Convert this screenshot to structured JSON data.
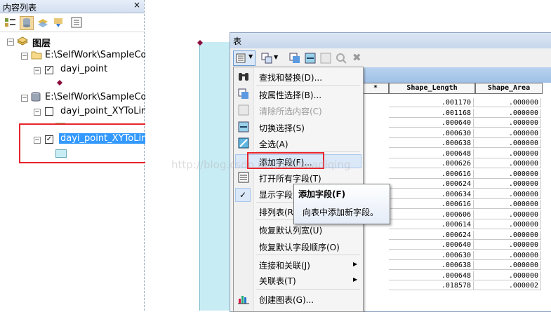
{
  "toc": {
    "title": "内容列表",
    "pin_glyph": "ᅟ",
    "close_glyph": "×",
    "layers_root": "图层",
    "workspace1": "E:\\SelfWork\\SampleCo",
    "layer1": "dayi_point",
    "workspace2": "E:\\SelfWork\\SampleCo",
    "layer2": "dayi_point_XYToLine",
    "layer3": "dayi_point_XYToLine"
  },
  "table_window": {
    "title": "表"
  },
  "grid": {
    "headers": [
      "*",
      "Shape_Length",
      "Shape_Area"
    ],
    "rows": [
      [
        ".001170",
        ".000000"
      ],
      [
        ".001168",
        ".000000"
      ],
      [
        ".000640",
        ".000000"
      ],
      [
        ".000630",
        ".000000"
      ],
      [
        ".000638",
        ".000000"
      ],
      [
        ".000648",
        ".000000"
      ],
      [
        ".000626",
        ".000000"
      ],
      [
        ".000616",
        ".000000"
      ],
      [
        ".000624",
        ".000000"
      ],
      [
        ".000634",
        ".000000"
      ],
      [
        ".000616",
        ".000000"
      ],
      [
        ".000606",
        ".000000"
      ],
      [
        ".000614",
        ".000000"
      ],
      [
        ".000624",
        ".000000"
      ],
      [
        ".000640",
        ".000000"
      ],
      [
        ".000630",
        ".000000"
      ],
      [
        ".000638",
        ".000000"
      ],
      [
        ".000648",
        ".000000"
      ],
      [
        ".018578",
        ".000002"
      ]
    ]
  },
  "menu": {
    "find_replace": "查找和替换(D)...",
    "select_by_attr": "按属性选择(B)...",
    "clear_selection": "清除所选内容(C)",
    "switch_selection": "切换选择(S)",
    "select_all": "全选(A)",
    "add_field": "添加字段(F)...",
    "open_all_fields": "打开所有字段(T)",
    "show_field_aliases": "显示字段",
    "arrange_tables": "排列表(R)",
    "restore_col_width": "恢复默认列宽(U)",
    "restore_field_order": "恢复默认字段顺序(O)",
    "joins_relates": "连接和关联(J)",
    "related_tables": "关联表(T)",
    "create_graph": "创建图表(G)..."
  },
  "tooltip": {
    "title": "添加字段(F)",
    "description": "向表中添加新字段。"
  },
  "watermark": "http://blog.csdn.net/douhuadiqing",
  "colors": {
    "accent_red": "#e8242c",
    "highlight": "#3399ff",
    "line_fill": "#c8ecf4"
  }
}
